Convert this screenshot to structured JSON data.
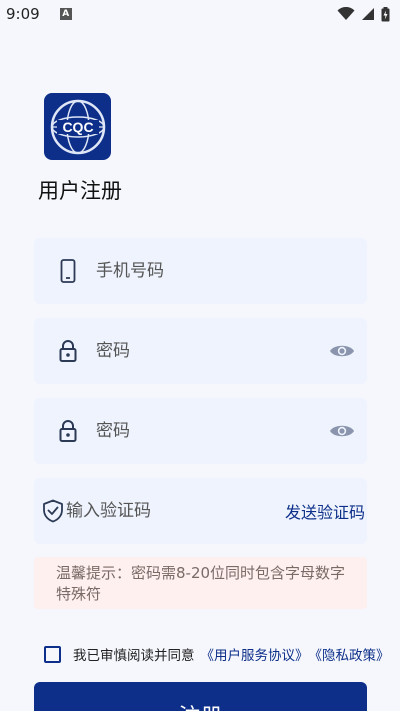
{
  "status_bar": {
    "time": "9:09",
    "notif_letter": "A"
  },
  "logo": {
    "text": "CQC"
  },
  "page_title": "用户注册",
  "fields": {
    "phone": {
      "placeholder": "手机号码"
    },
    "password": {
      "placeholder": "密码"
    },
    "confirm_password": {
      "placeholder": "密码"
    },
    "code": {
      "placeholder": "输入验证码",
      "send_label": "发送验证码"
    }
  },
  "tip": "温馨提示：密码需8-20位同时包含字母数字特殊符",
  "agreement": {
    "prefix": "我已审慎阅读并同意",
    "terms_link": "《用户服务协议》",
    "privacy_link": "《隐私政策》"
  },
  "submit_label": "注册",
  "colors": {
    "brand": "#0d2f8a",
    "field_bg": "#eef3fd",
    "tip_bg": "#fdf0ef"
  }
}
